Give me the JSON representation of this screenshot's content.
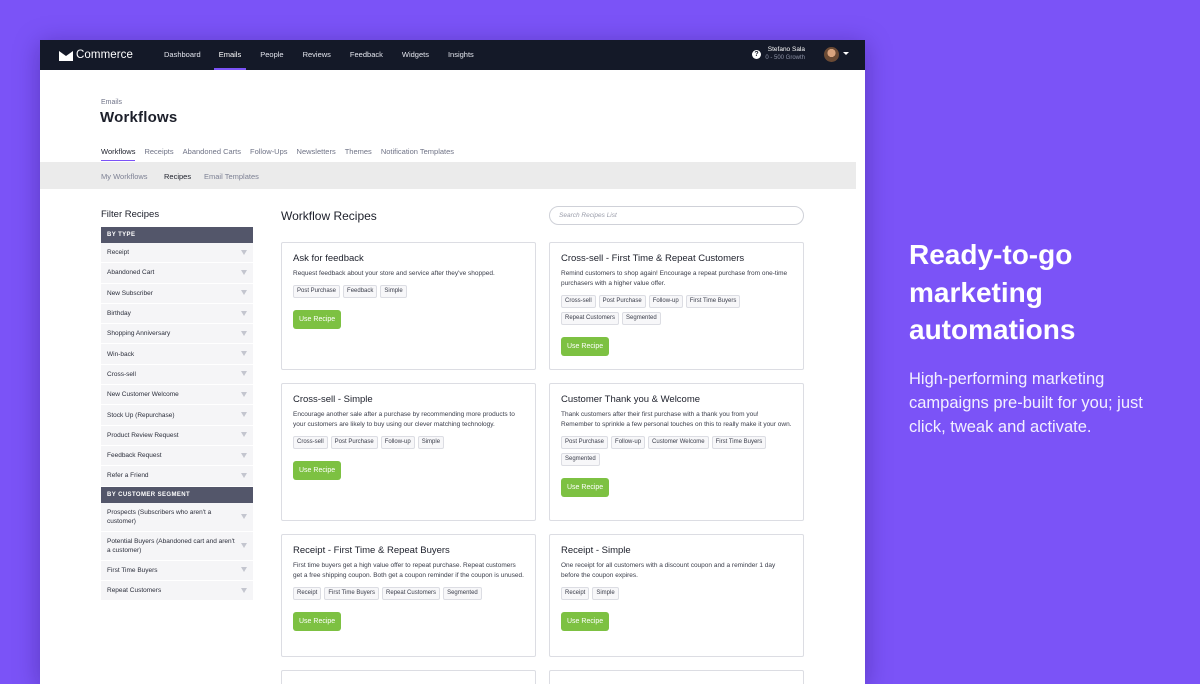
{
  "app": {
    "name": "Commerce",
    "nav": [
      "Dashboard",
      "Emails",
      "People",
      "Reviews",
      "Feedback",
      "Widgets",
      "Insights"
    ],
    "active_nav": "Emails",
    "help_icon": "question-circle-icon",
    "user": {
      "name": "Stefano Sala",
      "plan": "0 - 500 Growth"
    }
  },
  "page": {
    "breadcrumb": "Emails",
    "title": "Workflows",
    "tabs": [
      "Workflows",
      "Receipts",
      "Abandoned Carts",
      "Follow-Ups",
      "Newsletters",
      "Themes",
      "Notification Templates"
    ],
    "subtabs": [
      "My Workflows",
      "Recipes",
      "Email Templates"
    ]
  },
  "filter": {
    "title": "Filter Recipes",
    "by_type_label": "BY TYPE",
    "types": [
      "Receipt",
      "Abandoned Cart",
      "New Subscriber",
      "Birthday",
      "Shopping Anniversary",
      "Win-back",
      "Cross-sell",
      "New Customer Welcome",
      "Stock Up (Repurchase)",
      "Product Review Request",
      "Feedback Request",
      "Refer a Friend"
    ],
    "by_segment_label": "BY CUSTOMER SEGMENT",
    "segments": [
      "Prospects (Subscribers who aren't a customer)",
      "Potential Buyers (Abandoned cart and aren't a customer)",
      "First Time Buyers",
      "Repeat Customers"
    ]
  },
  "recipes": {
    "title": "Workflow Recipes",
    "search_placeholder": "Search Recipes List",
    "button_label": "Use Recipe",
    "cards": [
      {
        "title": "Ask for feedback",
        "desc": "Request feedback about your store and service after they've shopped.",
        "tags": [
          "Post Purchase",
          "Feedback",
          "Simple"
        ]
      },
      {
        "title": "Cross-sell - First Time & Repeat Customers",
        "desc": "Remind customers to shop again! Encourage a repeat purchase from one-time purchasers with a higher value offer.",
        "tags": [
          "Cross-sell",
          "Post Purchase",
          "Follow-up",
          "First Time Buyers",
          "Repeat Customers",
          "Segmented"
        ]
      },
      {
        "title": "Cross-sell - Simple",
        "desc": "Encourage another sale after a purchase by recommending more products to your customers are likely to buy using our clever matching technology.",
        "tags": [
          "Cross-sell",
          "Post Purchase",
          "Follow-up",
          "Simple"
        ]
      },
      {
        "title": "Customer Thank you & Welcome",
        "desc": "Thank customers after their first purchase with a thank you from you! Remember to sprinkle a few personal touches on this to really make it your own.",
        "tags": [
          "Post Purchase",
          "Follow-up",
          "Customer Welcome",
          "First Time Buyers",
          "Segmented"
        ]
      },
      {
        "title": "Receipt - First Time & Repeat Buyers",
        "desc": "First time buyers get a high value offer to repeat purchase. Repeat customers get a free shipping coupon. Both get a coupon reminder if the coupon is unused.",
        "tags": [
          "Receipt",
          "First Time Buyers",
          "Repeat Customers",
          "Segmented"
        ]
      },
      {
        "title": "Receipt - Simple",
        "desc": "One receipt for all customers with a discount coupon and a reminder 1 day before the coupon expires.",
        "tags": [
          "Receipt",
          "Simple"
        ]
      }
    ]
  },
  "promo": {
    "title": "Ready-to-go marketing automations",
    "text": "High-performing marketing campaigns pre-built for you; just click, tweak and activate."
  },
  "colors": {
    "background": "#7b53f7",
    "topbar": "#141928",
    "accent": "#7b53f7",
    "button": "#7dc142"
  }
}
